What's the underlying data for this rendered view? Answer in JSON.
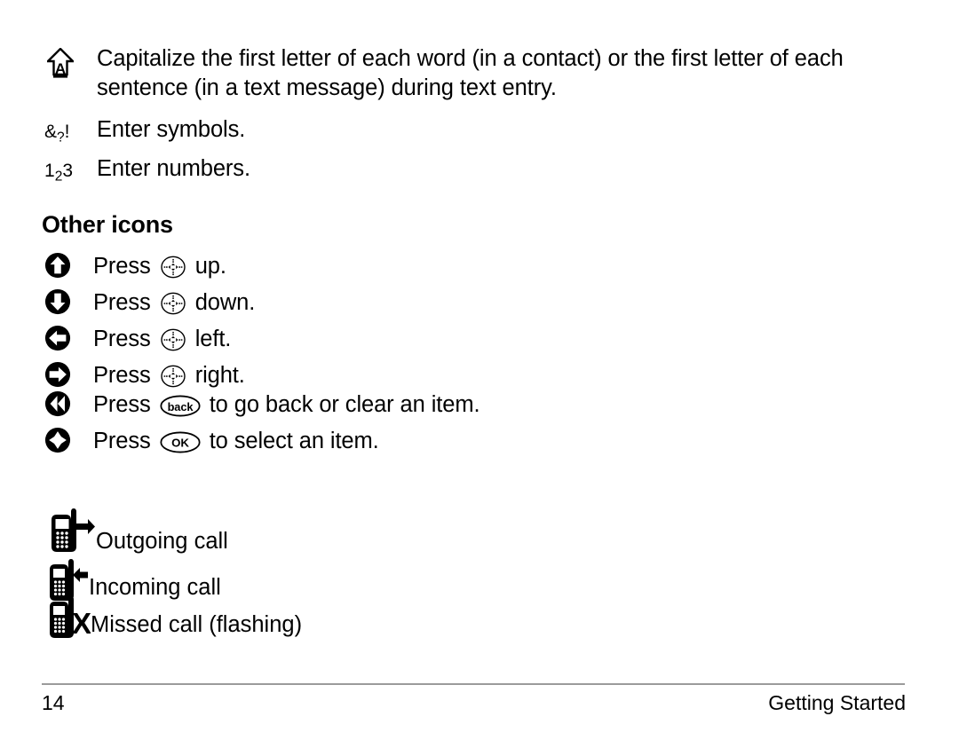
{
  "page": {
    "entry_modes": [
      {
        "icon": "capslock-arrow-a-icon",
        "text": "Capitalize the first letter of each word (in a contact) or the first letter of each sentence (in a text message) during text entry."
      },
      {
        "icon": "symbols-mode-icon",
        "glyph_pre": "&",
        "glyph_sub": "?",
        "glyph_post": "!",
        "text": "Enter symbols."
      },
      {
        "icon": "numbers-mode-icon",
        "glyph_pre": "1",
        "glyph_sub": "2",
        "glyph_post": "3",
        "text": "Enter numbers."
      }
    ],
    "other_icons_heading": "Other icons",
    "key_actions": [
      {
        "bullet": "arrow-up-circle-icon",
        "pre": "Press",
        "key": "navigation-key-icon",
        "key_label": "",
        "post": "up."
      },
      {
        "bullet": "arrow-down-circle-icon",
        "pre": "Press",
        "key": "navigation-key-icon",
        "key_label": "",
        "post": "down."
      },
      {
        "bullet": "arrow-left-circle-icon",
        "pre": "Press",
        "key": "navigation-key-icon",
        "key_label": "",
        "post": "left."
      },
      {
        "bullet": "arrow-right-circle-icon",
        "pre": "Press",
        "key": "navigation-key-icon",
        "key_label": "",
        "post": "right."
      },
      {
        "bullet": "back-circle-icon",
        "pre": "Press",
        "key": "back-key-icon",
        "key_label": "back",
        "post": "to go back or clear an item."
      },
      {
        "bullet": "select-circle-icon",
        "pre": "Press",
        "key": "ok-key-icon",
        "key_label": "OK",
        "post": "to select an item."
      }
    ],
    "call_icons": [
      {
        "icon": "outgoing-call-icon",
        "label": "Outgoing call"
      },
      {
        "icon": "incoming-call-icon",
        "label": "Incoming call"
      },
      {
        "icon": "missed-call-icon",
        "label": "Missed call (flashing)"
      }
    ],
    "footer": {
      "page_number": "14",
      "section": "Getting Started"
    },
    "colors": {
      "ink": "#000000",
      "rule": "#9b9b9b",
      "paper": "#ffffff"
    }
  }
}
